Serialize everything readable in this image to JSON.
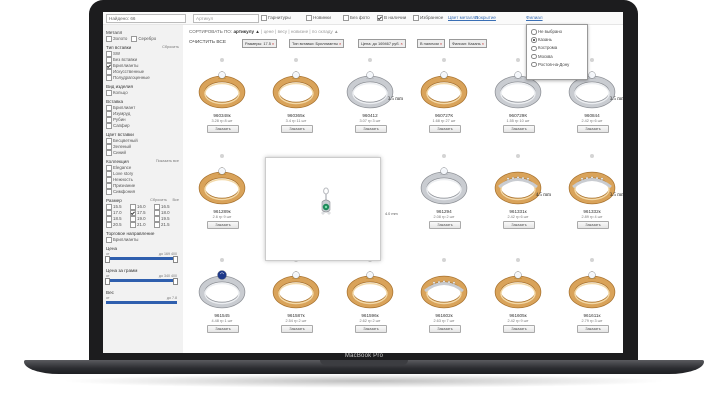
{
  "device": {
    "label": "MacBook Pro"
  },
  "topbar": {
    "search_value": "Найдено: 66",
    "article_placeholder": "Артикул",
    "options": [
      {
        "label": "Гарнитуры",
        "checked": false
      },
      {
        "label": "Новинки",
        "checked": false
      },
      {
        "label": "Без фото",
        "checked": false
      },
      {
        "label": "В наличии",
        "checked": true
      },
      {
        "label": "Избранное",
        "checked": false
      }
    ],
    "links": [
      "Цвет металла",
      "Покрытие",
      "Филиал"
    ]
  },
  "city_dropdown": {
    "options": [
      {
        "label": "Не выбрано",
        "selected": false
      },
      {
        "label": "Казань",
        "selected": true
      },
      {
        "label": "Кострома",
        "selected": false
      },
      {
        "label": "Москва",
        "selected": false
      },
      {
        "label": "Ростов-на-Дону",
        "selected": false
      }
    ]
  },
  "sidebar": {
    "metal": {
      "title": "Металл",
      "options": [
        {
          "label": "Золото",
          "checked": false
        },
        {
          "label": "Серебро",
          "checked": false
        }
      ]
    },
    "insert_type": {
      "title": "Тип вставки",
      "aside": "Сбросить",
      "options": [
        {
          "label": "SW",
          "checked": false
        },
        {
          "label": "Без вставки",
          "checked": false
        },
        {
          "label": "Бриллианты",
          "checked": true
        },
        {
          "label": "Искусственные",
          "checked": false
        },
        {
          "label": "Полудрагоценные",
          "checked": false
        }
      ]
    },
    "item_type": {
      "title": "Вид изделия",
      "options": [
        {
          "label": "Кольцо",
          "checked": false
        }
      ]
    },
    "insert": {
      "title": "Вставка",
      "options": [
        {
          "label": "Бриллиант",
          "checked": false
        },
        {
          "label": "Изумруд",
          "checked": false
        },
        {
          "label": "Рубин",
          "checked": false
        },
        {
          "label": "Сапфир",
          "checked": false
        }
      ]
    },
    "insert_color": {
      "title": "Цвет вставки",
      "options": [
        {
          "label": "Бесцветный",
          "checked": false
        },
        {
          "label": "Зеленый",
          "checked": false
        },
        {
          "label": "Синий",
          "checked": false
        }
      ]
    },
    "collection": {
      "title": "Коллекция",
      "aside": "Показать все",
      "options": [
        {
          "label": "Elegance",
          "checked": false
        },
        {
          "label": "Love story",
          "checked": false
        },
        {
          "label": "Нежность",
          "checked": false
        },
        {
          "label": "Признание",
          "checked": false
        },
        {
          "label": "Симфония",
          "checked": false
        }
      ]
    },
    "size": {
      "title": "Размер",
      "aside_reset": "Сбросить",
      "aside_all": "Все",
      "options": [
        {
          "label": "15.5",
          "checked": false
        },
        {
          "label": "16.0",
          "checked": false
        },
        {
          "label": "16.5",
          "checked": false
        },
        {
          "label": "17.0",
          "checked": false
        },
        {
          "label": "17.5",
          "checked": true
        },
        {
          "label": "18.0",
          "checked": false
        },
        {
          "label": "18.5",
          "checked": false
        },
        {
          "label": "19.0",
          "checked": false
        },
        {
          "label": "19.5",
          "checked": false
        },
        {
          "label": "20.5",
          "checked": false
        },
        {
          "label": "21.0",
          "checked": false
        },
        {
          "label": "21.5",
          "checked": false
        }
      ]
    },
    "trade": {
      "title": "Торговое направление",
      "options": [
        {
          "label": "Бриллианты",
          "checked": false
        }
      ]
    },
    "price": {
      "title": "Цена",
      "from": "от",
      "to": "до 169 400"
    },
    "price_gram": {
      "title": "Цена за грамм",
      "from": "от",
      "to": "до 340 400"
    },
    "weight": {
      "title": "Вес",
      "from": "от",
      "to": "до 7.8"
    }
  },
  "sort": {
    "label": "СОРТИРОВАТЬ ПО:",
    "active": "артикулу ▲",
    "others": "| цене | весу | новизне | по складу ▲"
  },
  "filters": {
    "clear_all": "ОЧИСТИТЬ ВСЕ",
    "chips": [
      "Размеры: 17.5",
      "Тип вставки: Бриллианты",
      "Цена: до 169467 руб.",
      "В наличии",
      "Филиал: Казань"
    ]
  },
  "products": [
    {
      "sku": "960348к",
      "meta": "3.28 гр   8 шт",
      "order_label": "Заказать",
      "metal": "gold",
      "stone": "clear",
      "size_tag": ""
    },
    {
      "sku": "960365к",
      "meta": "3.4 гр   11 шт",
      "order_label": "Заказать",
      "metal": "gold",
      "stone": "clear",
      "size_tag": ""
    },
    {
      "sku": "960412",
      "meta": "3.07 гр   3 шт",
      "order_label": "Заказать",
      "metal": "white",
      "stone": "clear",
      "size_tag": "3.5 mm"
    },
    {
      "sku": "960727К",
      "meta": "1.68 гр   27 шт",
      "order_label": "Заказать",
      "metal": "gold",
      "stone": "clear",
      "size_tag": ""
    },
    {
      "sku": "960729К",
      "meta": "1.55 гр   10 шт",
      "order_label": "Заказать",
      "metal": "white",
      "stone": "clear",
      "size_tag": ""
    },
    {
      "sku": "960844",
      "meta": "2.42 гр   6 шт",
      "order_label": "Заказать",
      "metal": "white",
      "stone": "clear",
      "size_tag": "3.5 mm"
    },
    {
      "sku": "961289к",
      "meta": "2.6 гр   9 шт",
      "order_label": "Заказать",
      "metal": "gold",
      "stone": "clear",
      "size_tag": ""
    },
    {
      "sku": "961294",
      "meta": "2.08 гр   2 шт",
      "order_label": "Заказать",
      "metal": "white",
      "stone": "clear",
      "size_tag": ""
    },
    {
      "sku": "961331к",
      "meta": "2.42 гр   6 шт",
      "order_label": "Заказать",
      "metal": "two",
      "stone": "clear",
      "size_tag": "4.5 mm"
    },
    {
      "sku": "961332к",
      "meta": "2.89 гр   4 шт",
      "order_label": "Заказать",
      "metal": "two",
      "stone": "clear",
      "size_tag": "3.5 mm"
    },
    {
      "sku": "961545",
      "meta": "4.48 гр   1 шт",
      "order_label": "Заказать",
      "metal": "white",
      "stone": "sapphire",
      "size_tag": ""
    },
    {
      "sku": "961587к",
      "meta": "2.54 гр   2 шт",
      "order_label": "Заказать",
      "metal": "gold",
      "stone": "clear",
      "size_tag": ""
    },
    {
      "sku": "961596к",
      "meta": "2.62 гр   2 шт",
      "order_label": "Заказать",
      "metal": "gold",
      "stone": "clear",
      "size_tag": ""
    },
    {
      "sku": "961602к",
      "meta": "2.63 гр   7 шт",
      "order_label": "Заказать",
      "metal": "two",
      "stone": "clear",
      "size_tag": ""
    },
    {
      "sku": "961605к",
      "meta": "2.42 гр   9 шт",
      "order_label": "Заказать",
      "metal": "gold",
      "stone": "clear",
      "size_tag": ""
    },
    {
      "sku": "961611к",
      "meta": "2.79 гр   3 шт",
      "order_label": "Заказать",
      "metal": "gold",
      "stone": "clear",
      "size_tag": ""
    }
  ],
  "zoom_preview": {
    "side_text": "4.0 mm"
  },
  "colors": {
    "accent": "#2f5fae",
    "gold": "#d9a35a",
    "white_gold": "#c9ccd1",
    "sapphire": "#1f3a8a",
    "emerald": "#1f8a5a"
  }
}
